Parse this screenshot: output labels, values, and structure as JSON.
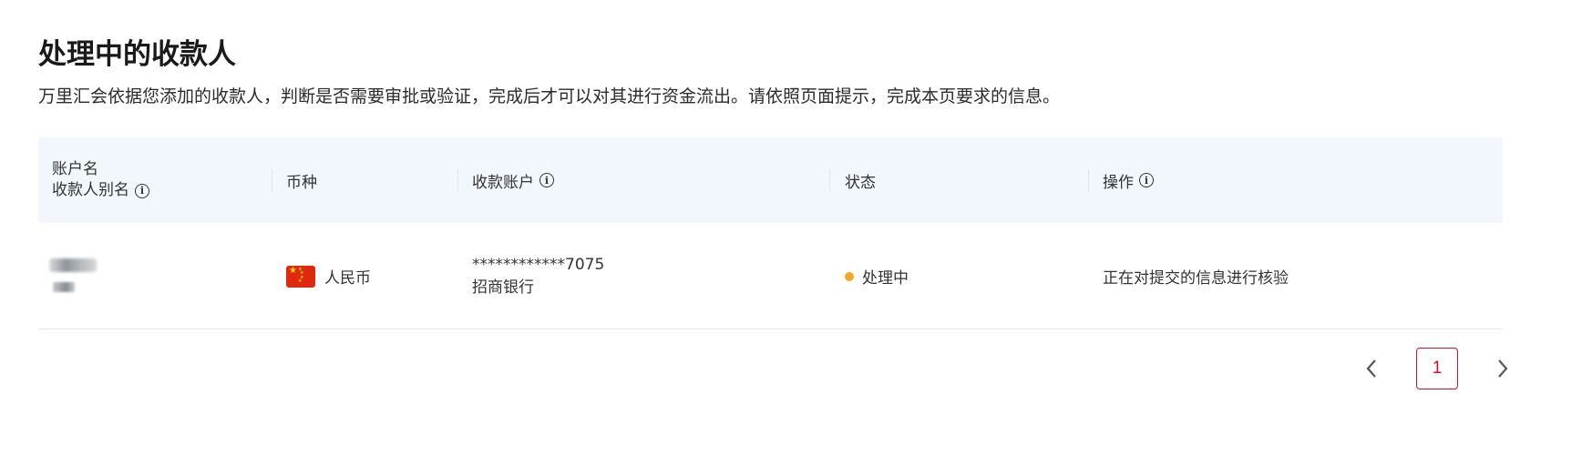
{
  "page": {
    "title": "处理中的收款人",
    "description": "万里汇会依据您添加的收款人，判断是否需要审批或验证，完成后才可以对其进行资金流出。请依照页面提示，完成本页要求的信息。"
  },
  "table": {
    "headers": {
      "account_name": "账户名",
      "payee_alias": "收款人别名",
      "currency": "币种",
      "account": "收款账户",
      "status": "状态",
      "action": "操作"
    },
    "rows": [
      {
        "currency_name": "人民币",
        "currency_flag": "cn-flag-icon",
        "account_number": "************7075",
        "bank_name": "招商银行",
        "status": "处理中",
        "status_color": "#f5a623",
        "action_text": "正在对提交的信息进行核验"
      }
    ]
  },
  "pagination": {
    "current_page": "1",
    "prev_icon": "chevron-left-icon",
    "next_icon": "chevron-right-icon",
    "accent_color": "#d0132b"
  }
}
